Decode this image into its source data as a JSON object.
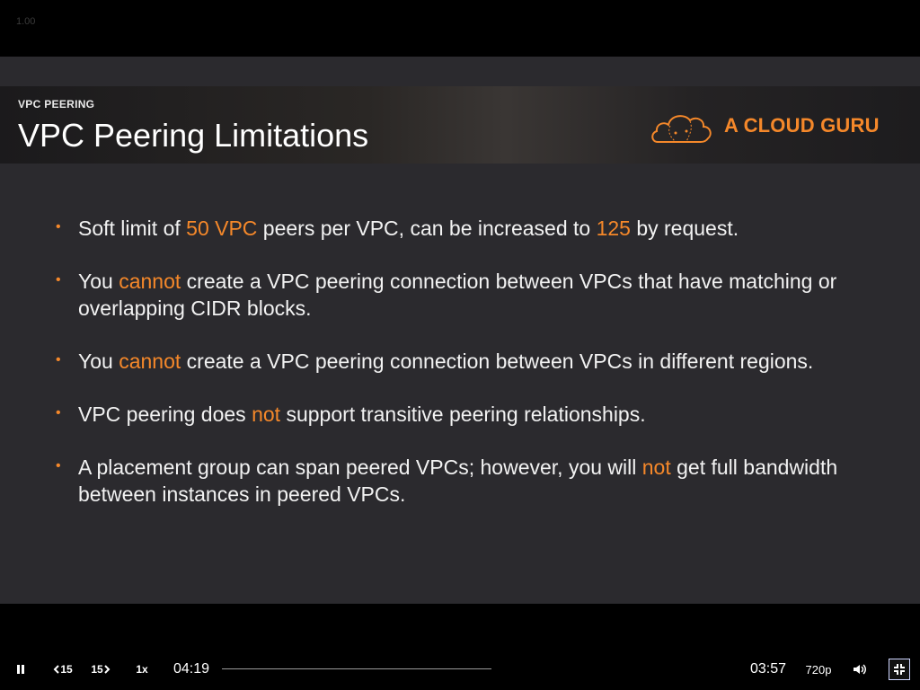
{
  "zoom": "1.00",
  "slide": {
    "section_label": "VPC PEERING",
    "title": "VPC Peering Limitations",
    "logo_text": "A CLOUD GURU",
    "bullets": [
      [
        {
          "t": "Soft limit of ",
          "hl": false
        },
        {
          "t": "50 VPC",
          "hl": true
        },
        {
          "t": " peers per VPC, can be increased to ",
          "hl": false
        },
        {
          "t": "125",
          "hl": true
        },
        {
          "t": " by request.",
          "hl": false
        }
      ],
      [
        {
          "t": "You ",
          "hl": false
        },
        {
          "t": "cannot",
          "hl": true
        },
        {
          "t": " create a VPC peering connection between VPCs that have matching or overlapping CIDR blocks.",
          "hl": false
        }
      ],
      [
        {
          "t": "You ",
          "hl": false
        },
        {
          "t": "cannot",
          "hl": true
        },
        {
          "t": " create a VPC peering connection between VPCs in different regions.",
          "hl": false
        }
      ],
      [
        {
          "t": "VPC peering does ",
          "hl": false
        },
        {
          "t": "not",
          "hl": true
        },
        {
          "t": " support transitive peering relationships.",
          "hl": false
        }
      ],
      [
        {
          "t": "A placement group can span peered VPCs; however, you will ",
          "hl": false
        },
        {
          "t": "not",
          "hl": true
        },
        {
          "t": " get full bandwidth between instances in peered VPCs.",
          "hl": false
        }
      ]
    ],
    "accent_color": "#f5882a"
  },
  "player": {
    "rewind_label": "15",
    "forward_label": "15",
    "speed_label": "1x",
    "current_time": "04:19",
    "remaining_time": "03:57",
    "progress_fraction": 0.0,
    "quality_label": "720p",
    "icons": {
      "pause": "pause-icon",
      "rewind": "rewind-15-icon",
      "forward": "forward-15-icon",
      "volume": "volume-icon",
      "fullscreen": "exit-fullscreen-icon"
    }
  }
}
